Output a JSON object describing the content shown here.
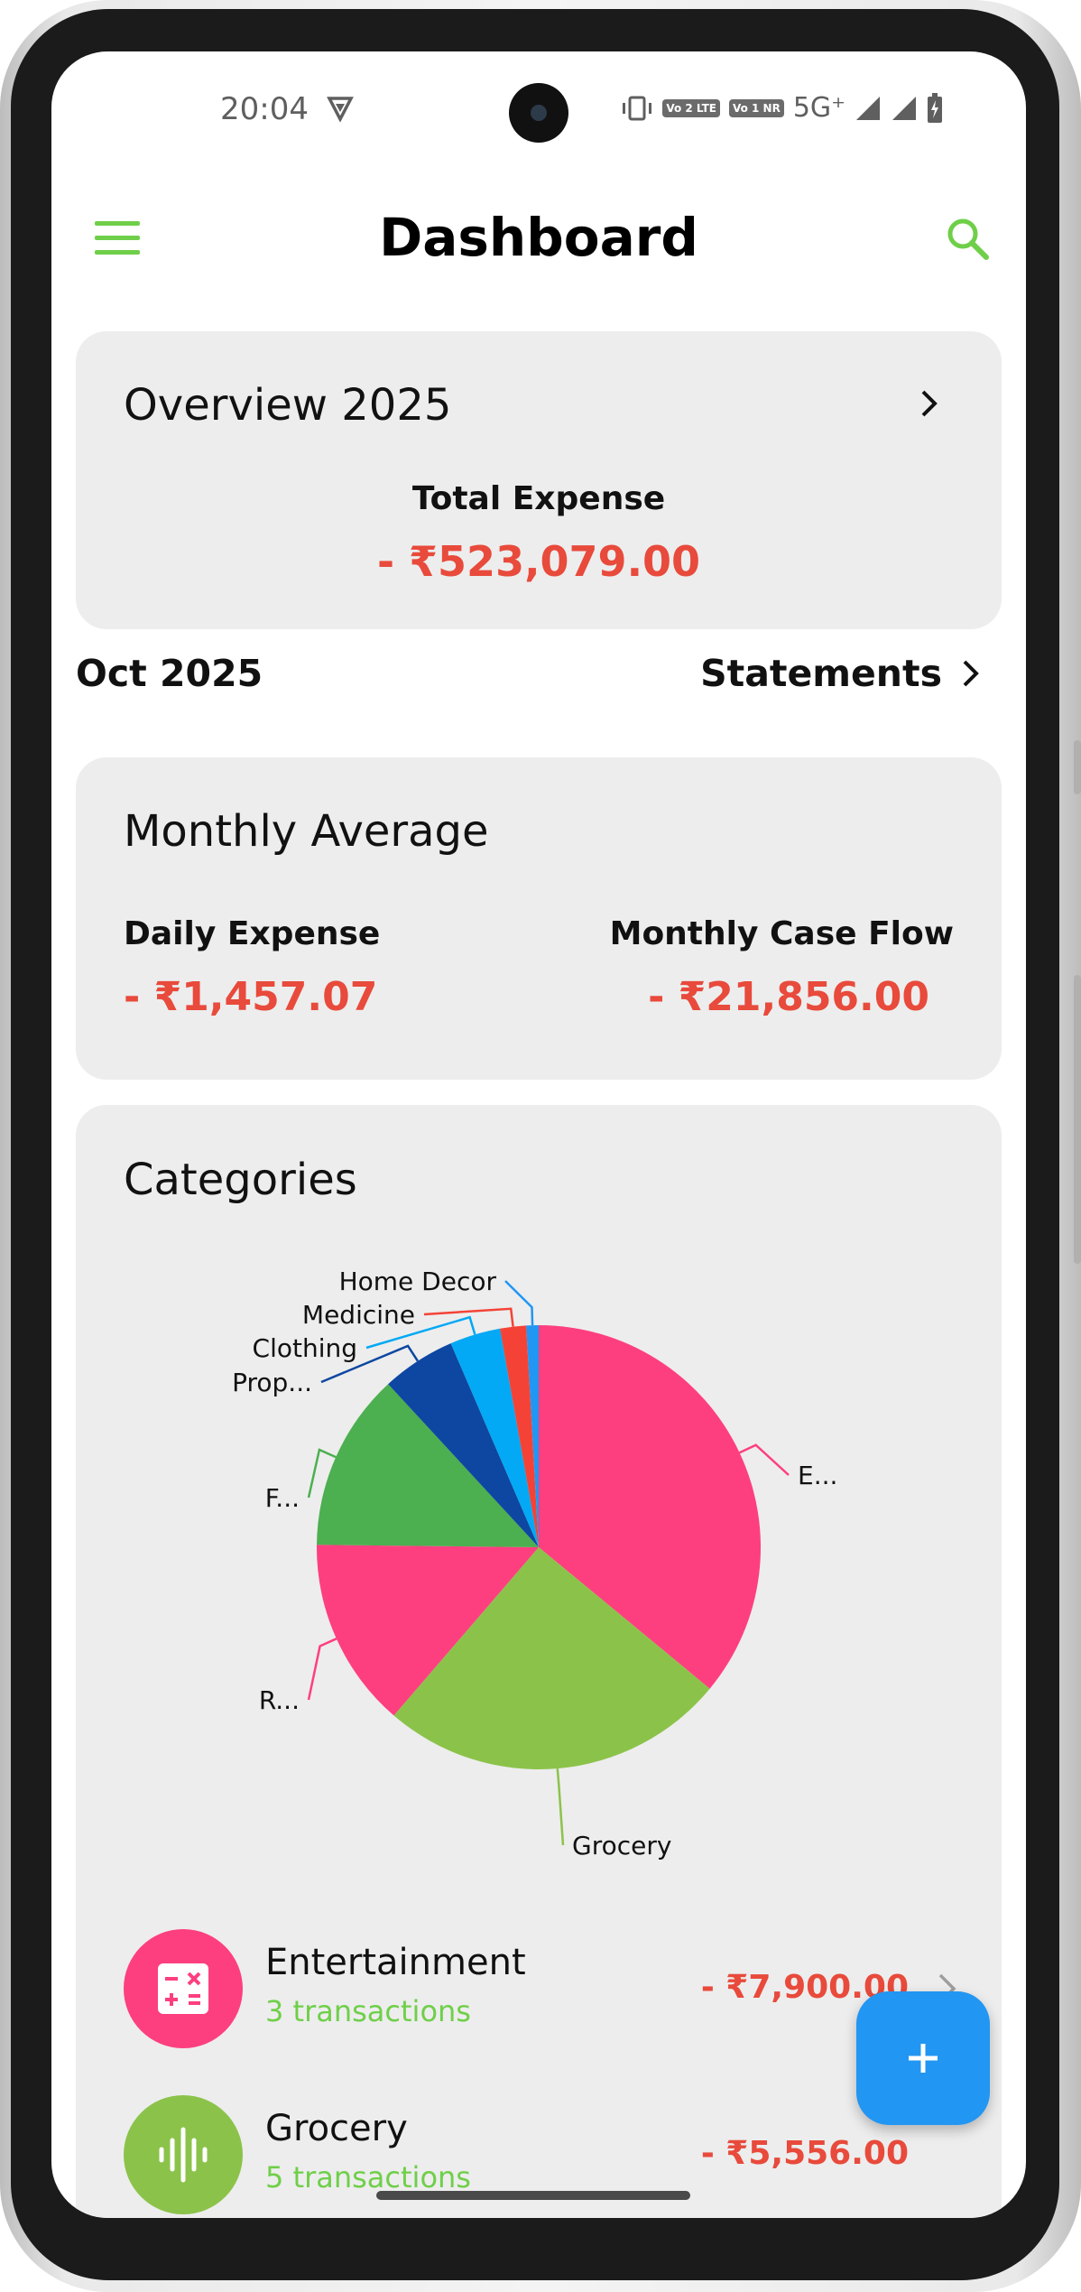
{
  "status_bar": {
    "time": "20:04",
    "network": "5G⁺",
    "chips": [
      "Vo 2 LTE",
      "Vo 1 NR"
    ],
    "icons": [
      "vpn-icon",
      "vibrate-icon",
      "signal-icon",
      "signal-icon",
      "battery-charging-icon"
    ]
  },
  "app_bar": {
    "title": "Dashboard",
    "menu_icon": "hamburger-menu-icon",
    "search_icon": "search-icon"
  },
  "overview": {
    "title": "Overview 2025",
    "label": "Total Expense",
    "amount": "- ₹523,079.00"
  },
  "period": {
    "month": "Oct 2025",
    "statements_label": "Statements"
  },
  "monthly_average": {
    "title": "Monthly Average",
    "daily_label": "Daily Expense",
    "daily_amount": "- ₹1,457.07",
    "cashflow_label": "Monthly Case Flow",
    "cashflow_amount": "- ₹21,856.00"
  },
  "categories": {
    "title": "Categories",
    "items": [
      {
        "name": "Entertainment",
        "transactions": "3 transactions",
        "amount": "- ₹7,900.00",
        "color": "#fd3f7f",
        "icon": "calculator-icon"
      },
      {
        "name": "Grocery",
        "transactions": "5 transactions",
        "amount": "- ₹5,556.00",
        "color": "#8bc34a",
        "icon": "sound-wave-icon"
      }
    ]
  },
  "chart_data": {
    "type": "pie",
    "slices": [
      {
        "label": "E...",
        "value": 36.1,
        "color": "#fd3f7f"
      },
      {
        "label": "Grocery",
        "value": 25.4,
        "color": "#8bc34a"
      },
      {
        "label": "R...",
        "value": 13.9,
        "color": "#fd3f7f"
      },
      {
        "label": "F...",
        "value": 13.0,
        "color": "#4caf50"
      },
      {
        "label": "Prop...",
        "value": 5.4,
        "color": "#0d47a1"
      },
      {
        "label": "Clothing",
        "value": 3.7,
        "color": "#03a9f4"
      },
      {
        "label": "Medicine",
        "value": 1.9,
        "color": "#f44336"
      },
      {
        "label": "Home Decor",
        "value": 0.9,
        "color": "#2196f3"
      }
    ]
  },
  "fab": {
    "icon": "plus-icon"
  },
  "colors": {
    "accent": "#6fcf49",
    "expense": "#e84a3b",
    "card": "#ededed",
    "fab": "#2196f3"
  }
}
